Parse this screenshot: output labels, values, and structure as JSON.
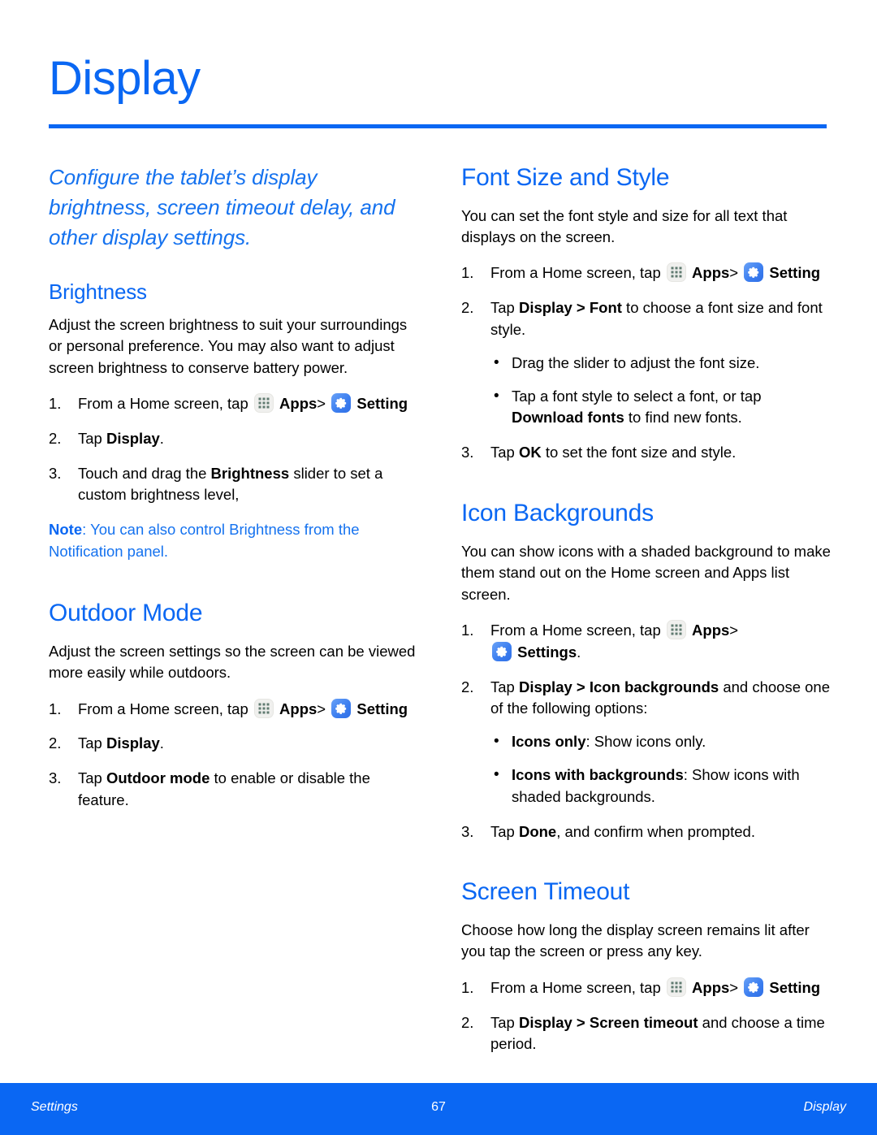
{
  "page": {
    "title": "Display",
    "intro": "Configure the tablet’s display brightness, screen timeout delay, and other display settings.",
    "accent_color": "#0a67f3",
    "note_color": "#1572ef"
  },
  "icons": {
    "apps": "apps-grid-icon",
    "settings": "settings-gear-icon"
  },
  "left_column": {
    "brightness": {
      "heading": "Brightness",
      "body": "Adjust the screen brightness to suit your surroundings or personal preference. You may also want to adjust screen brightness to conserve battery power.",
      "steps": [
        {
          "num": "1.",
          "pre": "From a Home screen, tap",
          "apps_label": "Apps",
          "sep": ">",
          "settings_label": "Setting"
        },
        {
          "num": "2.",
          "text_pre": "Tap ",
          "bold": "Display",
          "text_post": "."
        },
        {
          "num": "3.",
          "text_pre": "Touch and drag the ",
          "bold": "Brightness",
          "text_post": " slider to set a custom brightness level,"
        }
      ],
      "note_label": "Note",
      "note_text": ": You can also control Brightness from the Notification panel."
    },
    "outdoor_mode": {
      "heading": "Outdoor Mode",
      "body": "Adjust the screen settings so the screen can be viewed more easily while outdoors.",
      "steps": [
        {
          "num": "1.",
          "pre": "From a Home screen, tap",
          "apps_label": "Apps",
          "sep": ">",
          "settings_label": "Setting"
        },
        {
          "num": "2.",
          "text_pre": "Tap ",
          "bold": "Display",
          "text_post": "."
        },
        {
          "num": "3.",
          "text_pre": "Tap ",
          "bold": "Outdoor mode",
          "text_post": " to enable or disable the feature."
        }
      ]
    }
  },
  "right_column": {
    "font_size_and_style": {
      "heading": "Font Size and Style",
      "body": "You can set the font style and size for all text that displays on the screen.",
      "step1": {
        "num": "1.",
        "pre": "From a Home screen, tap",
        "apps_label": "Apps",
        "sep": ">",
        "settings_label": "Setting"
      },
      "step2": {
        "num": "2.",
        "text_pre": "Tap ",
        "bold1": "Display > Font",
        "text_post": " to choose a font size and font style."
      },
      "bullets": [
        {
          "text": "Drag the slider to adjust the font size."
        },
        {
          "text_pre": "Tap a font style to select a font, or tap ",
          "bold": "Download fonts",
          "text_post": " to find new fonts."
        }
      ],
      "step3": {
        "num": "3.",
        "text_pre": "Tap ",
        "bold": "OK",
        "text_post": " to set the font size and style."
      }
    },
    "icon_backgrounds": {
      "heading": "Icon Backgrounds",
      "body": "You can show icons with a shaded background to make them stand out on the Home screen and Apps list screen.",
      "step1": {
        "num": "1.",
        "pre": "From a Home screen, tap",
        "apps_label": "Apps",
        "sep": ">",
        "settings_label": "Settings",
        "trailing": "."
      },
      "step2": {
        "num": "2.",
        "text_pre": "Tap ",
        "bold": "Display > Icon backgrounds",
        "text_post": " and choose one of the following options:"
      },
      "bullets": [
        {
          "bold": "Icons only",
          "text_post": ": Show icons only."
        },
        {
          "bold": "Icons with backgrounds",
          "text_post": ": Show icons with shaded backgrounds."
        }
      ],
      "step3": {
        "num": "3.",
        "text_pre": "Tap ",
        "bold": "Done",
        "text_post": ", and confirm when prompted."
      }
    },
    "screen_timeout": {
      "heading": "Screen Timeout",
      "body": "Choose how long the display screen remains lit after you tap the screen or press any key.",
      "step1": {
        "num": "1.",
        "pre": "From a Home screen, tap",
        "apps_label": "Apps",
        "sep": ">",
        "settings_label": "Setting"
      },
      "step2": {
        "num": "2.",
        "text_pre": "Tap ",
        "bold": "Display > Screen timeout",
        "text_post": " and choose a time period."
      }
    }
  },
  "footer": {
    "left": "Settings",
    "page_number": "67",
    "right": "Display"
  }
}
